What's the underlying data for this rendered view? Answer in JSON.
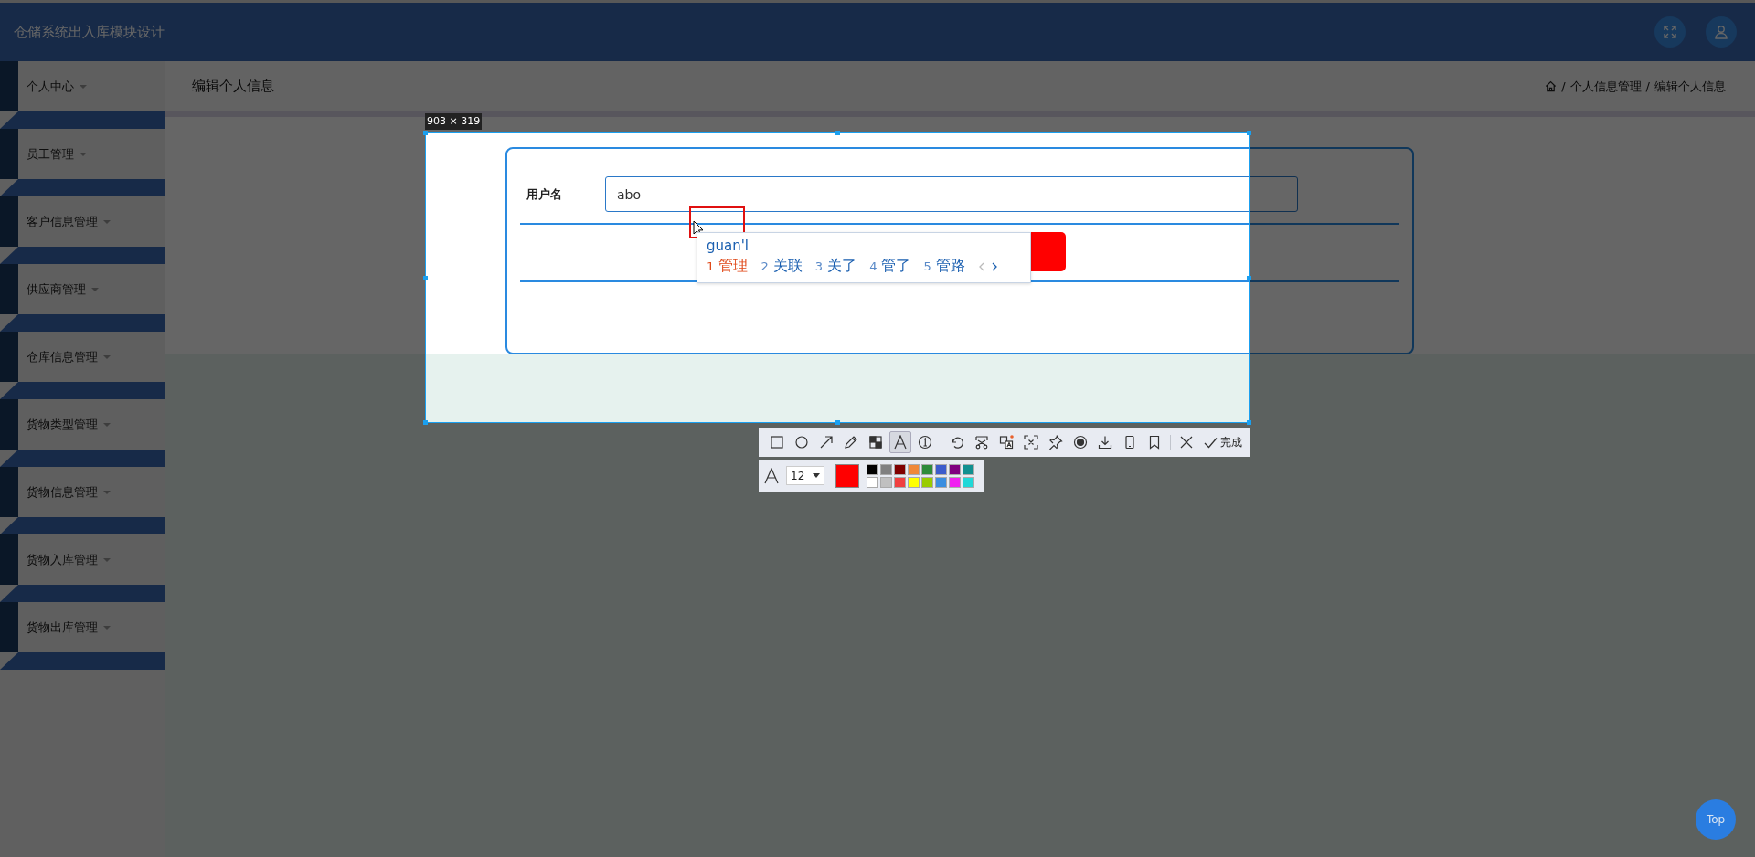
{
  "header": {
    "title": "仓储系统出入库模块设计"
  },
  "sidebar": {
    "items": [
      {
        "label": "个人中心"
      },
      {
        "label": "员工管理"
      },
      {
        "label": "客户信息管理"
      },
      {
        "label": "供应商管理"
      },
      {
        "label": "仓库信息管理"
      },
      {
        "label": "货物类型管理"
      },
      {
        "label": "货物信息管理"
      },
      {
        "label": "货物入库管理"
      },
      {
        "label": "货物出库管理"
      }
    ]
  },
  "breadcrumb": {
    "page_title": "编辑个人信息",
    "trail": [
      {
        "sep": "/",
        "label": "个人信息管理"
      },
      {
        "sep": "/",
        "label": "编辑个人信息"
      }
    ]
  },
  "form": {
    "fields": [
      {
        "label": "用户名",
        "value": "abo"
      }
    ]
  },
  "ime": {
    "composition": "guan'l",
    "candidates": [
      {
        "index": "1",
        "text": "管理",
        "selected": true
      },
      {
        "index": "2",
        "text": "关联",
        "selected": false
      },
      {
        "index": "3",
        "text": "关了",
        "selected": false
      },
      {
        "index": "4",
        "text": "管了",
        "selected": false
      },
      {
        "index": "5",
        "text": "管路",
        "selected": false
      }
    ]
  },
  "capture": {
    "size_label": "903 × 319",
    "tools": [
      {
        "kind": "rect",
        "selected": false
      },
      {
        "kind": "ellipse",
        "selected": false
      },
      {
        "kind": "arrow",
        "selected": false
      },
      {
        "kind": "pen",
        "selected": false
      },
      {
        "kind": "mosaic",
        "selected": false
      },
      {
        "kind": "text",
        "selected": true
      },
      {
        "kind": "number",
        "selected": false
      },
      {
        "kind": "separator"
      },
      {
        "kind": "undo",
        "selected": false
      },
      {
        "kind": "cut",
        "selected": false
      },
      {
        "kind": "translate",
        "selected": false
      },
      {
        "kind": "ocr",
        "selected": false
      },
      {
        "kind": "pin",
        "selected": false
      },
      {
        "kind": "record",
        "selected": false
      },
      {
        "kind": "download",
        "selected": false
      },
      {
        "kind": "phone",
        "selected": false
      },
      {
        "kind": "bookmark",
        "selected": false
      },
      {
        "kind": "separator"
      },
      {
        "kind": "close",
        "selected": false
      }
    ],
    "done_label": "完成",
    "font_size": "12",
    "current_swatch": {
      "color": "#ff0000"
    },
    "palette": [
      {
        "color": "#000000"
      },
      {
        "color": "#808080"
      },
      {
        "color": "#800000"
      },
      {
        "color": "#f08838"
      },
      {
        "color": "#2e8b3a"
      },
      {
        "color": "#3c5ccc"
      },
      {
        "color": "#800080"
      },
      {
        "color": "#109090"
      },
      {
        "color": "#ffffff"
      },
      {
        "color": "#c0c0c0"
      },
      {
        "color": "#f04040"
      },
      {
        "color": "#ffff00"
      },
      {
        "color": "#99cc00"
      },
      {
        "color": "#3a8ee0"
      },
      {
        "color": "#f020f0"
      },
      {
        "color": "#20d8d8"
      }
    ]
  },
  "back_to_top": "Top"
}
